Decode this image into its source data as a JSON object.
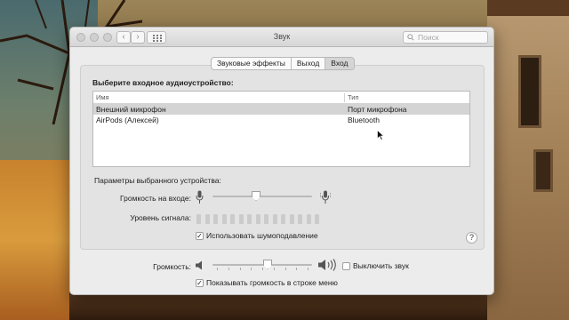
{
  "window": {
    "title": "Звук",
    "search_placeholder": "Поиск",
    "nav_back": "‹",
    "nav_forward": "›"
  },
  "tabs": [
    {
      "label": "Звуковые эффекты",
      "active": false
    },
    {
      "label": "Выход",
      "active": false
    },
    {
      "label": "Вход",
      "active": true
    }
  ],
  "input": {
    "section_title": "Выберите входное аудиоустройство:",
    "columns": {
      "name": "Имя",
      "type": "Тип"
    },
    "devices": [
      {
        "name": "Внешний микрофон",
        "type": "Порт микрофона",
        "selected": true
      },
      {
        "name": "AirPods (Алексей)",
        "type": "Bluetooth",
        "selected": false
      }
    ],
    "settings_title": "Параметры выбранного устройства:",
    "input_volume_label": "Громкость на входе:",
    "input_volume_level": 0.43,
    "signal_level_label": "Уровень сигнала:",
    "signal_level_bars_lit": 0,
    "signal_level_bars_total": 15,
    "noise_reduction_label": "Использовать шумоподавление",
    "noise_reduction_checked": true,
    "help_label": "?"
  },
  "output": {
    "volume_label": "Громкость:",
    "volume_level": 0.56,
    "mute_label": "Выключить звук",
    "mute_checked": false,
    "show_in_menu_label": "Показывать громкость в строке меню",
    "show_in_menu_checked": true
  },
  "colors": {
    "window_bg": "#ececec",
    "selected_row": "#d4d4d4",
    "track": "#b9b9b9"
  },
  "icons": [
    "search-icon",
    "microphone-low-icon",
    "microphone-high-icon",
    "speaker-low-icon",
    "speaker-high-icon",
    "help-icon",
    "grid-icon",
    "mouse-cursor-icon"
  ]
}
